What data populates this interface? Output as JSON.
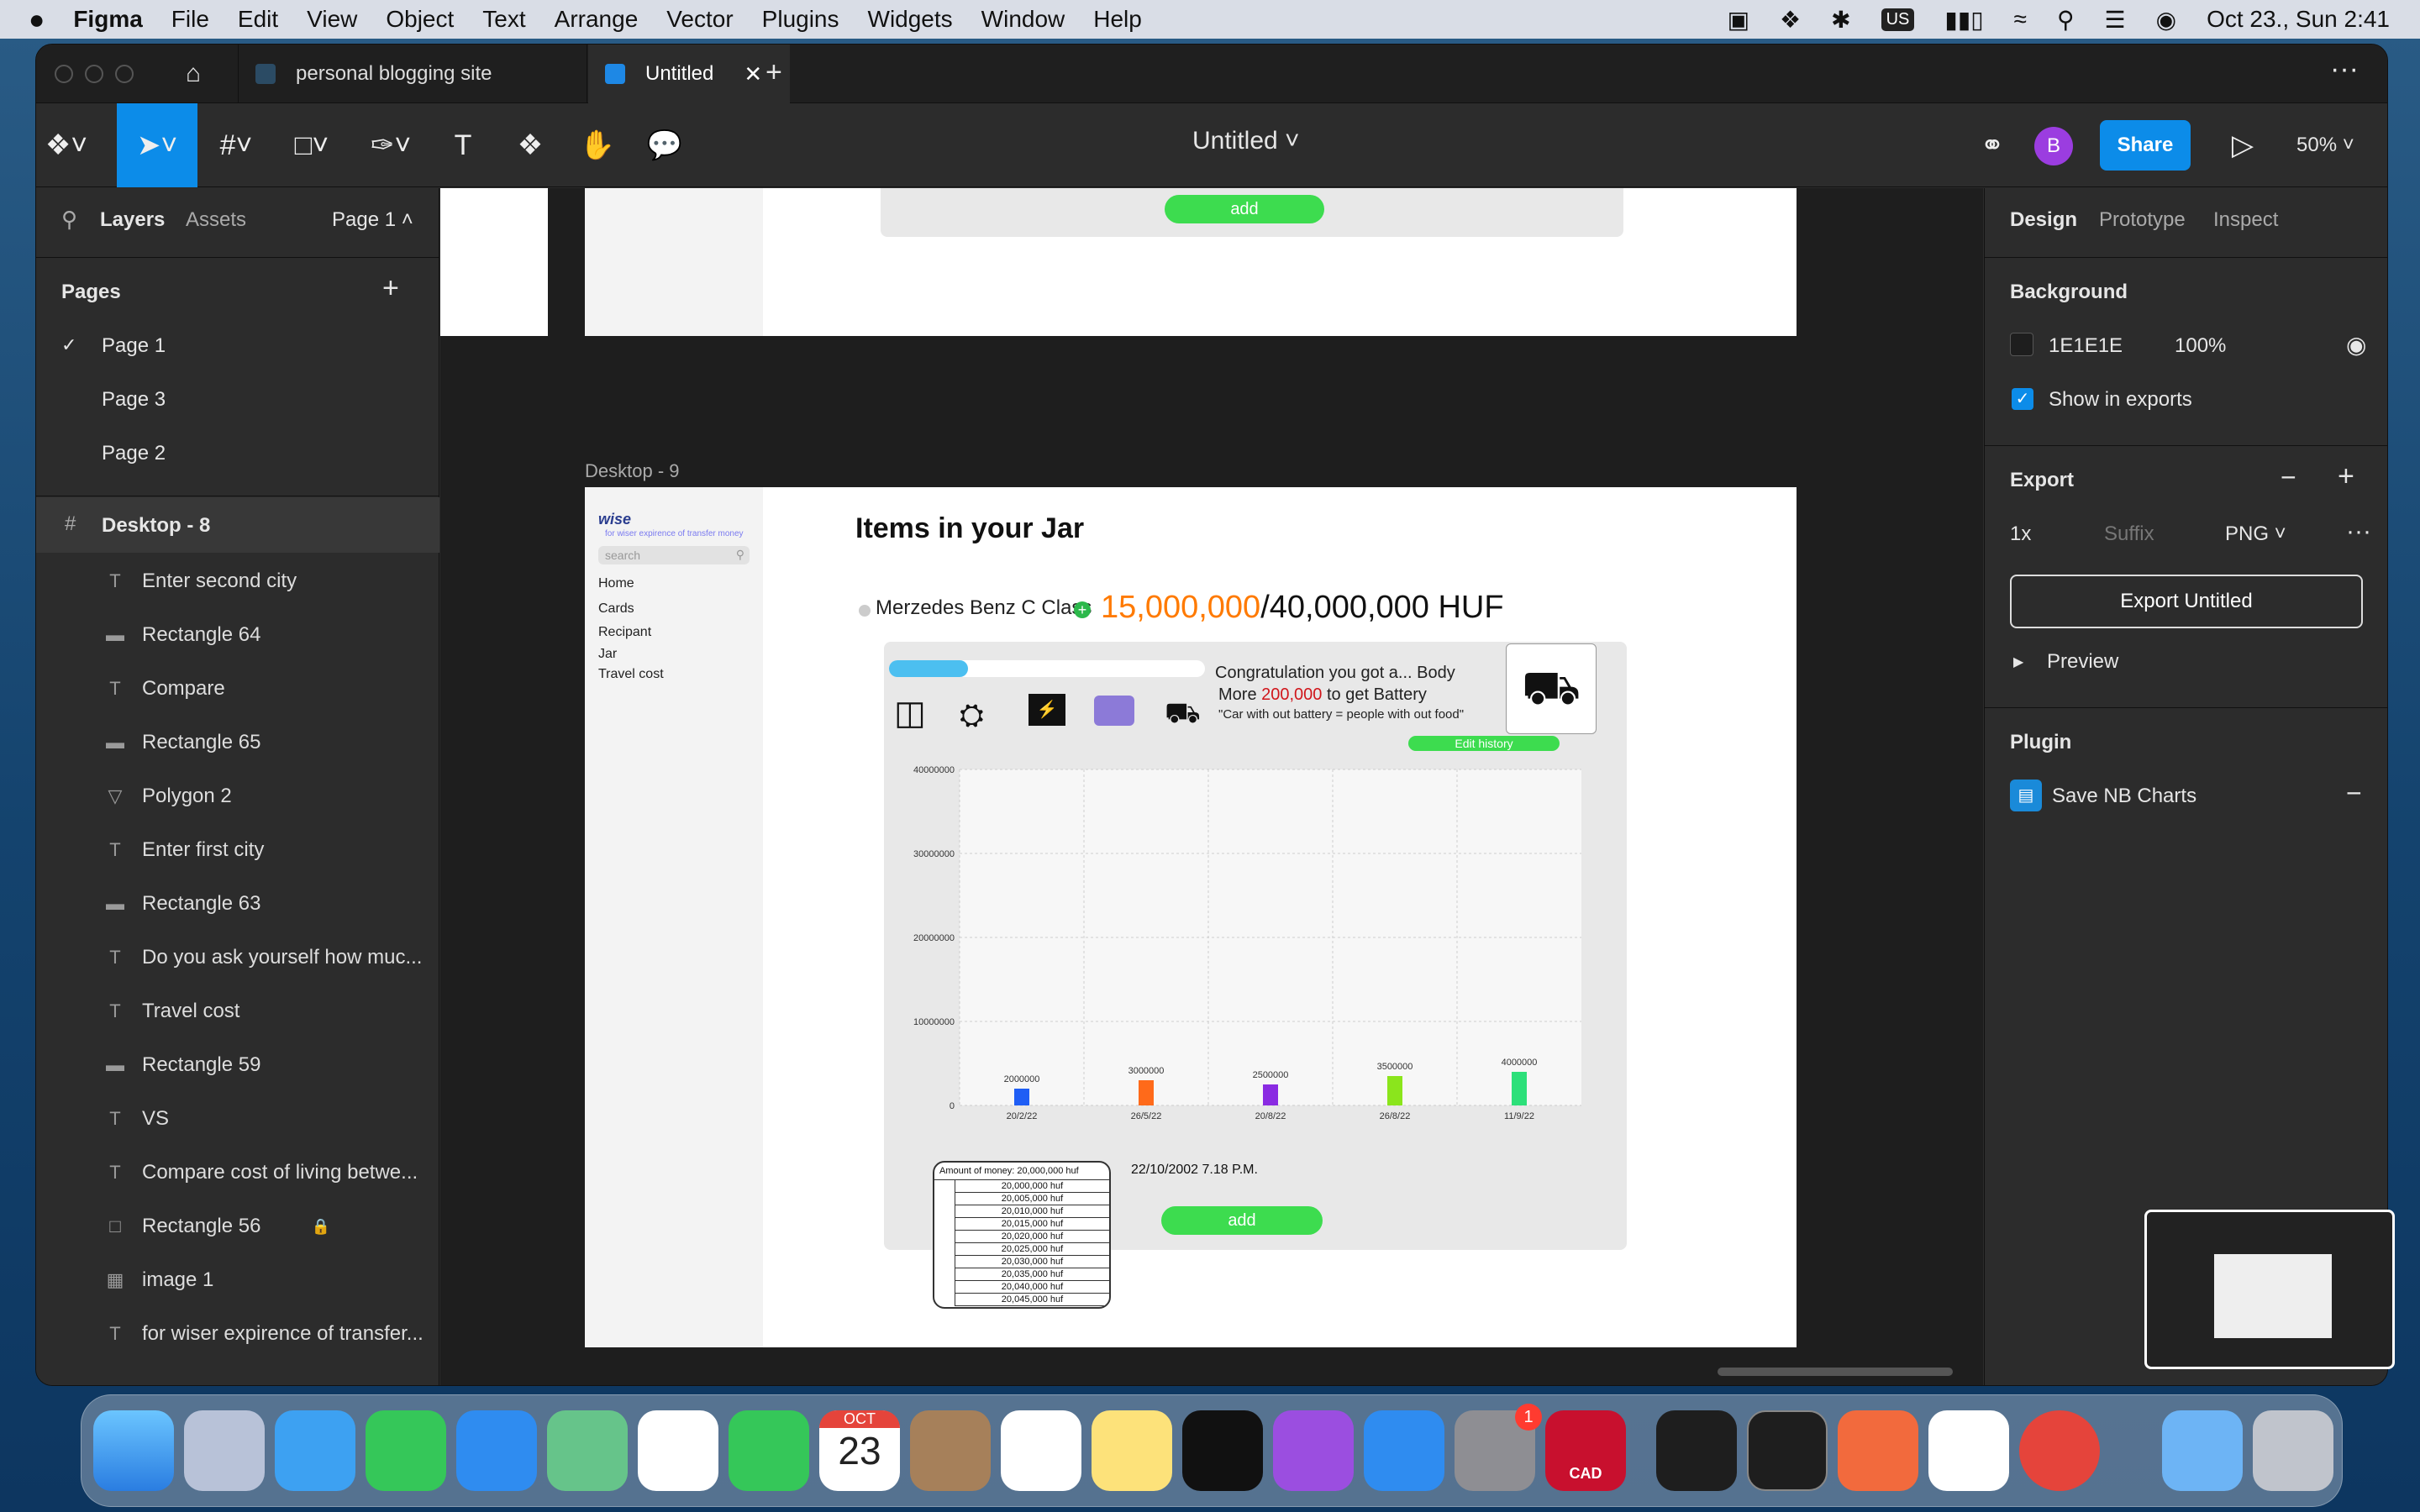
{
  "menubar": {
    "app": "Figma",
    "items": [
      "File",
      "Edit",
      "View",
      "Object",
      "Text",
      "Arrange",
      "Vector",
      "Plugins",
      "Widgets",
      "Window",
      "Help"
    ],
    "clock": "Oct 23., Sun  2:41",
    "input_badge": "US"
  },
  "tabs": [
    {
      "label": "personal blogging site"
    },
    {
      "label": "Untitled"
    }
  ],
  "toolbar": {
    "file_title": "Untitled",
    "share": "Share",
    "zoom": "50%",
    "avatar": "B"
  },
  "left": {
    "tab_layers": "Layers",
    "tab_assets": "Assets",
    "page_selector": "Page 1",
    "pages_title": "Pages",
    "pages": [
      "Page 1",
      "Page 3",
      "Page 2"
    ],
    "frame": "Desktop - 8",
    "layers": [
      {
        "type": "T",
        "name": "Enter second city"
      },
      {
        "type": "-",
        "name": "Rectangle 64"
      },
      {
        "type": "T",
        "name": "Compare"
      },
      {
        "type": "-",
        "name": "Rectangle 65"
      },
      {
        "type": "V",
        "name": "Polygon 2"
      },
      {
        "type": "T",
        "name": "Enter first city"
      },
      {
        "type": "-",
        "name": "Rectangle 63"
      },
      {
        "type": "T",
        "name": "Do you ask yourself how muc..."
      },
      {
        "type": "T",
        "name": "Travel cost"
      },
      {
        "type": "-",
        "name": "Rectangle 59"
      },
      {
        "type": "T",
        "name": "VS"
      },
      {
        "type": "T",
        "name": "Compare cost of living betwe..."
      },
      {
        "type": "R",
        "name": "Rectangle 56"
      },
      {
        "type": "I",
        "name": "image 1"
      },
      {
        "type": "T",
        "name": "for wiser expirence of transfer..."
      }
    ]
  },
  "right": {
    "tabs": [
      "Design",
      "Prototype",
      "Inspect"
    ],
    "background_title": "Background",
    "bg_color": "1E1E1E",
    "bg_opacity": "100%",
    "show_exports": "Show in exports",
    "export_title": "Export",
    "scale": "1x",
    "suffix_placeholder": "Suffix",
    "format": "PNG",
    "export_button": "Export Untitled",
    "preview": "Preview",
    "plugin_title": "Plugin",
    "plugin_name": "Save NB Charts"
  },
  "canvas": {
    "top_add": "add",
    "frame_label": "Desktop - 9",
    "sidebar": {
      "logo": "wise",
      "tagline": "for wiser expirence of transfer money",
      "search": "search",
      "nav": [
        "Home",
        "Cards",
        "Recipant",
        "Jar",
        "Travel cost"
      ]
    },
    "heading": "Items in your Jar",
    "item_name": "Merzedes Benz C Class",
    "saved": "15,000,000",
    "goal": "/40,000,000 HUF",
    "congrats": "Congratulation you got a... Body",
    "more_prefix": "More ",
    "more_amount": "200,000",
    "more_suffix": " to get Battery",
    "quote": "\"Car with out battery = people with out food\"",
    "edit_history": "Edit history",
    "progress": 0.25,
    "amount_header": "Amount of money: 20,000,000 huf",
    "amounts": [
      "20,000,000 huf",
      "20,005,000 huf",
      "20,010,000 huf",
      "20,015,000 huf",
      "20,020,000 huf",
      "20,025,000 huf",
      "20,030,000 huf",
      "20,035,000 huf",
      "20,040,000 huf",
      "20,045,000 huf"
    ],
    "timestamp": "22/10/2002 7.18 P.M.",
    "add": "add"
  },
  "chart_data": {
    "type": "bar",
    "categories": [
      "20/2/22",
      "26/5/22",
      "20/8/22",
      "26/8/22",
      "11/9/22"
    ],
    "values": [
      2000000,
      3000000,
      2500000,
      3500000,
      4000000
    ],
    "ylim": [
      0,
      40000000
    ],
    "yticks": [
      "0",
      "10000000",
      "20000000",
      "30000000",
      "40000000"
    ],
    "colors": [
      "#1f5ef5",
      "#ff6a1a",
      "#8a2be2",
      "#8be51c",
      "#2de07a"
    ],
    "grid": true,
    "title": "",
    "xlabel": "",
    "ylabel": ""
  },
  "dock": {
    "calendar_month": "OCT",
    "calendar_day": "23",
    "badge": "1",
    "cad": "CAD"
  }
}
